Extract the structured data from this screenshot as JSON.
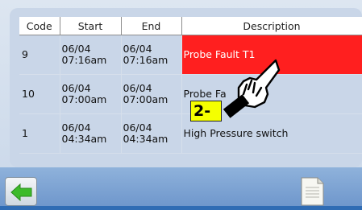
{
  "table": {
    "headers": {
      "code": "Code",
      "start": "Start",
      "end": "End",
      "description": "Description"
    },
    "rows": [
      {
        "code": "9",
        "start": "06/04\n07:16am",
        "end": "06/04\n07:16am",
        "description": "Probe Fault T1",
        "highlight": true
      },
      {
        "code": "10",
        "start": "06/04\n07:00am",
        "end": "06/04\n07:00am",
        "description": "Probe Fa",
        "highlight": false
      },
      {
        "code": "1",
        "start": "06/04\n04:34am",
        "end": "06/04\n04:34am",
        "description": "High Pressure switch",
        "highlight": false
      }
    ]
  },
  "overlay": {
    "step_label": "2-"
  },
  "icons": {
    "back": "green-left-arrow-icon",
    "document": "document-icon",
    "hand": "pointing-hand-icon"
  },
  "colors": {
    "fault_row": "#ff1f1f",
    "badge": "#f5ff00",
    "back_arrow": "#3dbb2a"
  }
}
